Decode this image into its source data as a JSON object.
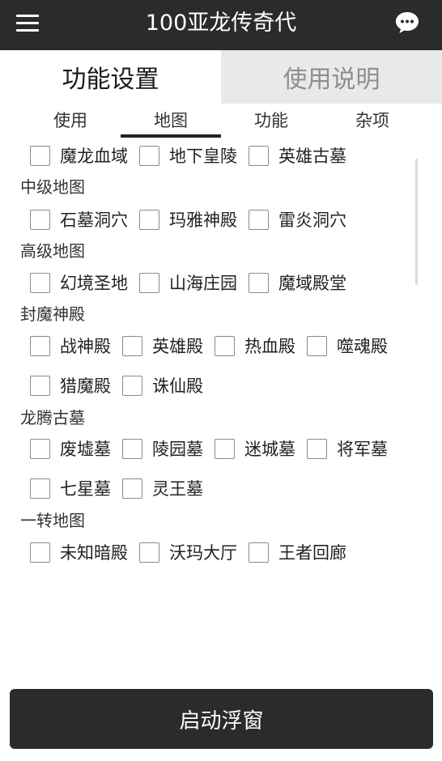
{
  "app": {
    "title": "100亚龙传奇代",
    "menu_icon": "hamburger-menu-icon",
    "chat_icon": "chat-bubble-icon",
    "topbar_color": "#2b2b2b"
  },
  "main_tabs": [
    {
      "label": "功能设置",
      "active": true
    },
    {
      "label": "使用说明",
      "active": false
    }
  ],
  "sub_tabs": [
    {
      "label": "使用",
      "active": false
    },
    {
      "label": "地图",
      "active": true
    },
    {
      "label": "功能",
      "active": false
    },
    {
      "label": "杂项",
      "active": false
    }
  ],
  "sections": {
    "top_row": [
      "魔龙血域",
      "地下皇陵",
      "英雄古墓"
    ],
    "mid": {
      "title": "中级地图",
      "items": [
        "石墓洞穴",
        "玛雅神殿",
        "雷炎洞穴"
      ]
    },
    "high": {
      "title": "高级地图",
      "items": [
        "幻境圣地",
        "山海庄园",
        "魔域殿堂"
      ]
    },
    "temple": {
      "title": "封魔神殿",
      "items": [
        "战神殿",
        "英雄殿",
        "热血殿",
        "噬魂殿",
        "猎魔殿",
        "诛仙殿"
      ]
    },
    "tomb": {
      "title": "龙腾古墓",
      "items": [
        "废墟墓",
        "陵园墓",
        "迷城墓",
        "将军墓",
        "七星墓",
        "灵王墓"
      ]
    },
    "first": {
      "title": "一转地图",
      "items": [
        "未知暗殿",
        "沃玛大厅",
        "王者回廊"
      ]
    }
  },
  "start_button": {
    "label": "启动浮窗"
  }
}
